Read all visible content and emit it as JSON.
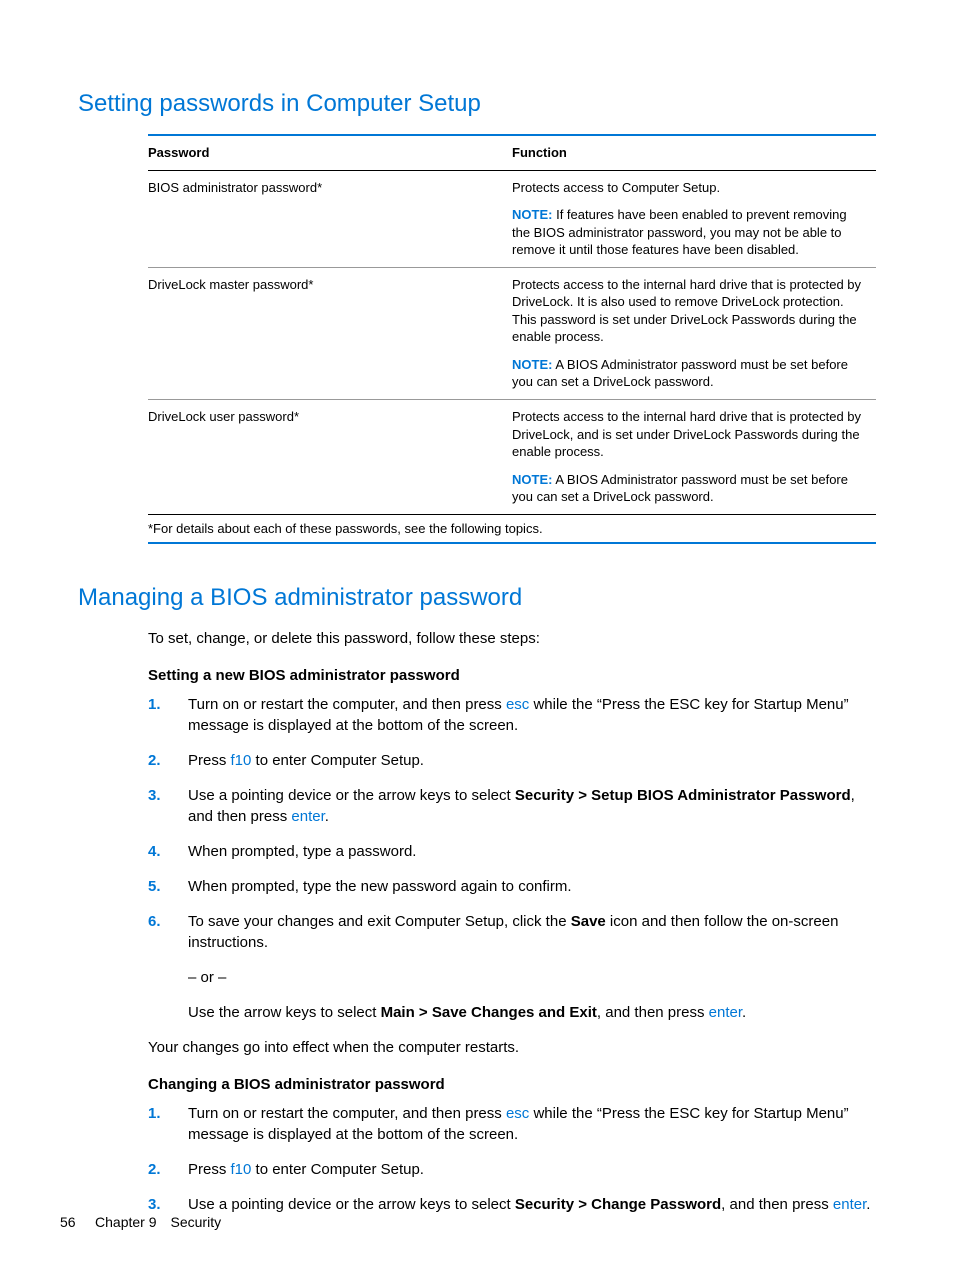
{
  "heading1": "Setting passwords in Computer Setup",
  "table": {
    "col1": "Password",
    "col2": "Function",
    "rows": [
      {
        "name": "BIOS administrator password*",
        "desc": "Protects access to Computer Setup.",
        "noteLabel": "NOTE:",
        "note": "If features have been enabled to prevent removing the BIOS administrator password, you may not be able to remove it until those features have been disabled."
      },
      {
        "name": "DriveLock master password*",
        "desc": "Protects access to the internal hard drive that is protected by DriveLock. It is also used to remove DriveLock protection. This password is set under DriveLock Passwords during the enable process.",
        "noteLabel": "NOTE:",
        "note": "A BIOS Administrator password must be set before you can set a DriveLock password."
      },
      {
        "name": "DriveLock user password*",
        "desc": "Protects access to the internal hard drive that is protected by DriveLock, and is set under DriveLock Passwords during the enable process.",
        "noteLabel": "NOTE:",
        "note": "A BIOS Administrator password must be set before you can set a DriveLock password."
      }
    ],
    "footnote": "*For details about each of these passwords, see the following topics."
  },
  "heading2": "Managing a BIOS administrator password",
  "intro2": "To set, change, or delete this password, follow these steps:",
  "sub1": "Setting a new BIOS administrator password",
  "steps1": {
    "s1a": "Turn on or restart the computer, and then press ",
    "s1key": "esc",
    "s1b": " while the “Press the ESC key for Startup Menu” message is displayed at the bottom of the screen.",
    "s2a": "Press ",
    "s2key": "f10",
    "s2b": " to enter Computer Setup.",
    "s3a": "Use a pointing device or the arrow keys to select ",
    "s3bold": "Security > Setup BIOS Administrator Password",
    "s3b": ", and then press ",
    "s3key": "enter",
    "s3c": ".",
    "s4": "When prompted, type a password.",
    "s5": "When prompted, type the new password again to confirm.",
    "s6a": "To save your changes and exit Computer Setup, click the ",
    "s6bold1": "Save",
    "s6b": " icon and then follow the on-screen instructions.",
    "s6or": "– or –",
    "s6c": "Use the arrow keys to select ",
    "s6bold2": "Main > Save Changes and Exit",
    "s6d": ", and then press ",
    "s6key": "enter",
    "s6e": "."
  },
  "after1": "Your changes go into effect when the computer restarts.",
  "sub2": "Changing a BIOS administrator password",
  "steps2": {
    "s1a": "Turn on or restart the computer, and then press ",
    "s1key": "esc",
    "s1b": " while the “Press the ESC key for Startup Menu” message is displayed at the bottom of the screen.",
    "s2a": "Press ",
    "s2key": "f10",
    "s2b": " to enter Computer Setup.",
    "s3a": "Use a pointing device or the arrow keys to select ",
    "s3bold": "Security > Change Password",
    "s3b": ", and then press ",
    "s3key": "enter",
    "s3c": "."
  },
  "footer": {
    "pageNum": "56",
    "chapter": "Chapter 9 Security"
  }
}
